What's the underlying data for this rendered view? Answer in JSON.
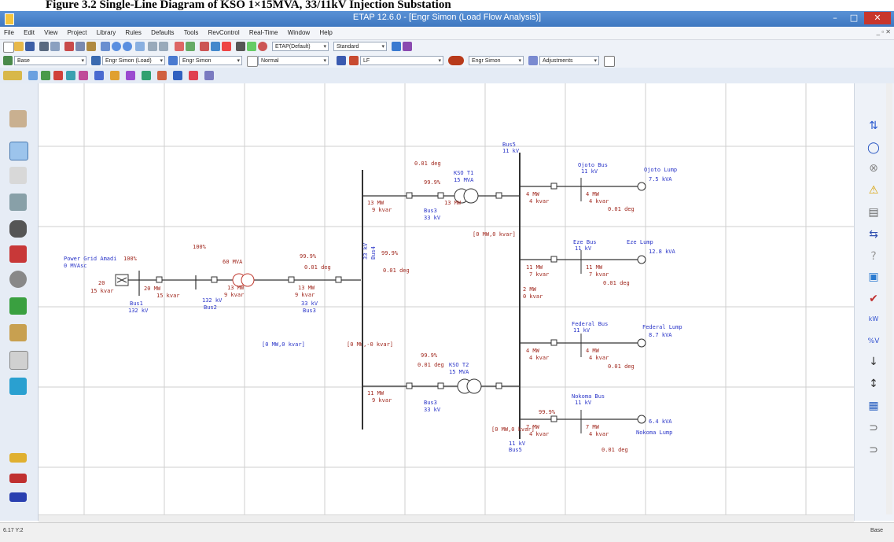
{
  "caption": "Figure 3.2 Single-Line Diagram of KSO 1×15MVA, 33/11kV Injection Substation",
  "window": {
    "title": "ETAP 12.6.0 - [Engr Simon (Load Flow Analysis)]",
    "min": "–",
    "max": "□",
    "close": "✕"
  },
  "menu": [
    "File",
    "Edit",
    "View",
    "Project",
    "Library",
    "Rules",
    "Defaults",
    "Tools",
    "RevControl",
    "Real-Time",
    "Window",
    "Help"
  ],
  "toolbar": {
    "config_combo": "ETAP(Default)",
    "standard_combo": "Standard",
    "base_combo": "Base",
    "study_case_combo": "Engr Simon (Load) ",
    "presentation_combo": "Engr Simon",
    "mode_combo": "Normal",
    "lf_combo": "LF",
    "output_combo": "Engr Simon",
    "adjust_combo": "Adjustments"
  },
  "status": {
    "coords": "6.17  Y:2",
    "mode": "Base"
  },
  "diagram": {
    "grid": {
      "name": "Power Grid Amadi",
      "rating": "0 MVAsc",
      "bus": "Bus1",
      "bus_kv": "132 kV",
      "flow_a": "100%",
      "flow_b": "100%",
      "mw": "20",
      "mvar": "15 kvar"
    },
    "t1": {
      "rating": "60 MVA",
      "flow1": "20 MW",
      "flow2": "15 kvar"
    },
    "bus2": {
      "name": "132 kV",
      "label": "Bus2"
    },
    "bus3": {
      "name": "33 kV",
      "label": "Bus3"
    },
    "bus33": {
      "name": "33 kV",
      "label": "Bus4"
    },
    "kso": {
      "name": "KSO T1",
      "rating": "15 MVA"
    },
    "kso2": {
      "name": "KSO T2",
      "rating": "15 MVA"
    },
    "bus11": {
      "name": "Bus5",
      "kv": "11 kV"
    },
    "feeders": [
      {
        "bus": "Ojoto Bus",
        "kv": "11 kV",
        "load": "Ojoto Lump",
        "rating": "7.5 kVA"
      },
      {
        "bus": "Eze Bus",
        "kv": "11 kV",
        "load": "Eze Lump",
        "rating": "12.8 kVA"
      },
      {
        "bus": "Federal Bus",
        "kv": "11 kV",
        "load": "Federal Lump",
        "rating": "8.7 kVA"
      },
      {
        "bus": "Nokoma Bus",
        "kv": "11 kV",
        "load": "Nokoma Lump",
        "rating": "6.4 kVA"
      }
    ],
    "flows": {
      "mw_small": "4 MW",
      "kvar_small": "4 kvar",
      "deg": "0.01 deg",
      "pct": "99.9%",
      "tie": "[0 MW,0 kvar]",
      "tie2": "[0 MW,-0 kvar]",
      "mw_main": "13 MW",
      "kvar_main": "9 kvar",
      "bus5_mw": "2 MW",
      "bus5_kvar": "0 kvar",
      "mw11": "11 MW",
      "kvar7": "7 kvar",
      "mw7": "7 MW"
    }
  },
  "colors": {
    "titlebar": "#3e77c0",
    "bus_label": "#2a35c8",
    "flow_label": "#a0281e",
    "grid_line": "#d0d0d0"
  }
}
